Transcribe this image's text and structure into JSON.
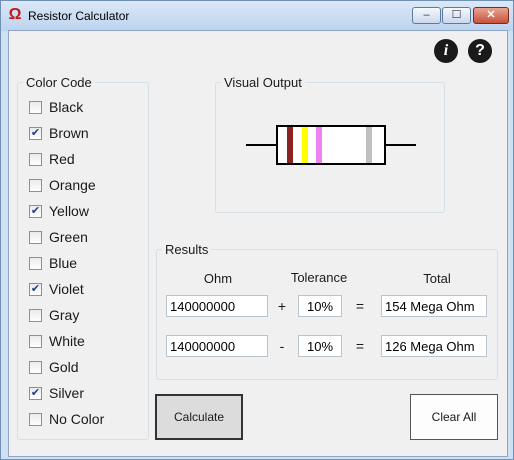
{
  "window": {
    "title": "Resistor Calculator",
    "controls": {
      "minimize": "–",
      "maximize": "☐",
      "close": "✕"
    }
  },
  "help": {
    "info": "i",
    "question": "?"
  },
  "color_code": {
    "legend": "Color Code",
    "items": [
      {
        "label": "Black",
        "checked": false
      },
      {
        "label": "Brown",
        "checked": true
      },
      {
        "label": "Red",
        "checked": false
      },
      {
        "label": "Orange",
        "checked": false
      },
      {
        "label": "Yellow",
        "checked": true
      },
      {
        "label": "Green",
        "checked": false
      },
      {
        "label": "Blue",
        "checked": false
      },
      {
        "label": "Violet",
        "checked": true
      },
      {
        "label": "Gray",
        "checked": false
      },
      {
        "label": "White",
        "checked": false
      },
      {
        "label": "Gold",
        "checked": false
      },
      {
        "label": "Silver",
        "checked": true
      },
      {
        "label": "No Color",
        "checked": false
      }
    ]
  },
  "visual_output": {
    "legend": "Visual Output",
    "band_colors": [
      "#8b2323",
      "#ffff00",
      "#ee82ee",
      "#c0c0c0"
    ]
  },
  "results": {
    "legend": "Results",
    "headers": {
      "ohm": "Ohm",
      "tolerance": "Tolerance",
      "total": "Total"
    },
    "rows": [
      {
        "ohm": "140000000",
        "operator": "+",
        "tolerance": "10%",
        "equals": "=",
        "total": "154 Mega Ohm"
      },
      {
        "ohm": "140000000",
        "operator": "-",
        "tolerance": "10%",
        "equals": "=",
        "total": "126 Mega Ohm"
      }
    ]
  },
  "buttons": {
    "calculate": "Calculate",
    "clear_all": "Clear All"
  }
}
